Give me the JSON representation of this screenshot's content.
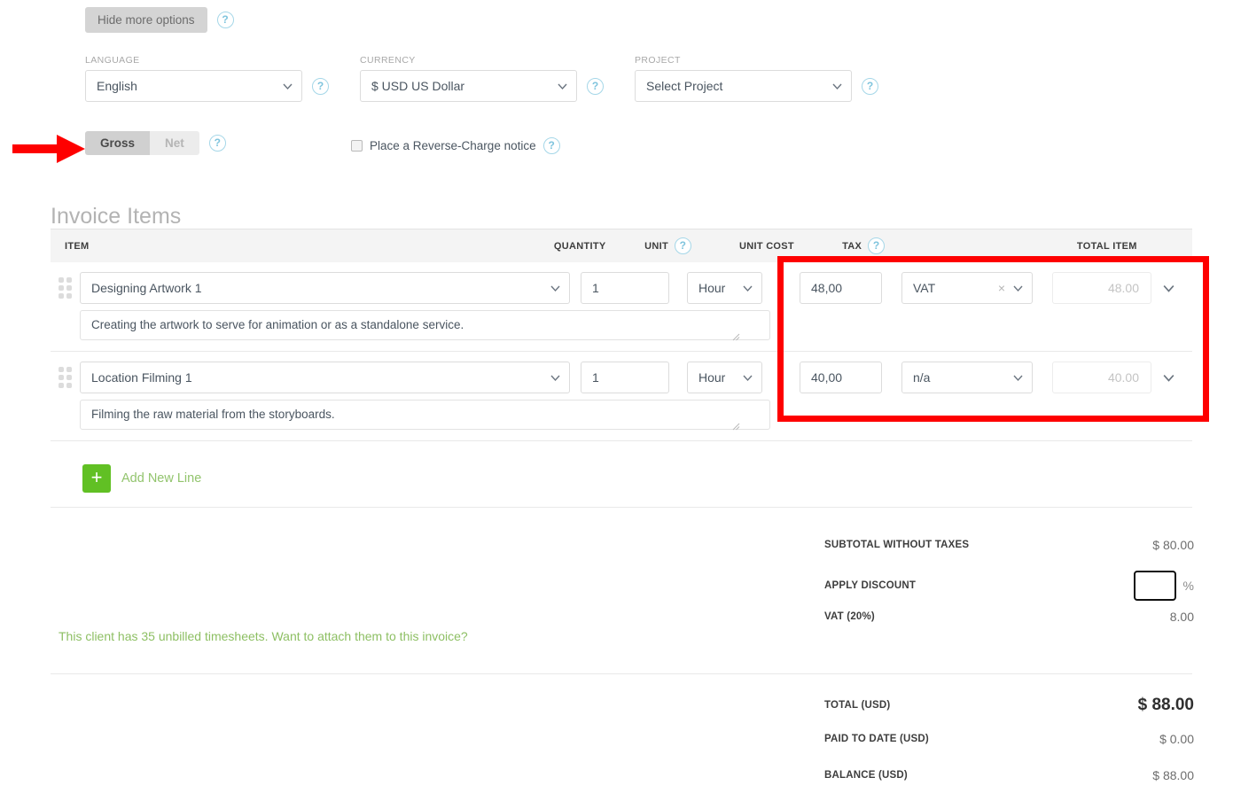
{
  "options": {
    "hide_more_label": "Hide more options",
    "help_icon": "help-icon"
  },
  "fields": {
    "language": {
      "label": "LANGUAGE",
      "value": "English"
    },
    "currency": {
      "label": "CURRENCY",
      "value": "$ USD US Dollar"
    },
    "project": {
      "label": "PROJECT",
      "value": "Select Project"
    }
  },
  "tax_mode": {
    "gross_label": "Gross",
    "net_label": "Net",
    "selected": "Gross"
  },
  "reverse_charge": {
    "label": "Place a Reverse-Charge notice",
    "checked": false
  },
  "items_section": {
    "title": "Invoice Items",
    "headers": {
      "item": "ITEM",
      "quantity": "QUANTITY",
      "unit": "UNIT",
      "unit_cost": "UNIT COST",
      "tax": "TAX",
      "total_item": "TOTAL ITEM"
    },
    "rows": [
      {
        "name": "Designing Artwork 1",
        "description": "Creating the artwork to serve for animation or as a standalone service.",
        "quantity": "1",
        "unit": "Hour",
        "unit_cost": "48,00",
        "tax": "VAT",
        "tax_clear": "×",
        "total": "48.00"
      },
      {
        "name": "Location Filming 1",
        "description": "Filming the raw material from the storyboards.",
        "quantity": "1",
        "unit": "Hour",
        "unit_cost": "40,00",
        "tax": "n/a",
        "tax_clear": "",
        "total": "40.00"
      }
    ],
    "add_new_line": "Add New Line",
    "add_plus": "+"
  },
  "timesheet_note": "This client has 35 unbilled timesheets. Want to attach them to this invoice?",
  "totals": {
    "subtotal_label": "SUBTOTAL WITHOUT TAXES",
    "subtotal_value": "$ 80.00",
    "discount_label": "APPLY DISCOUNT",
    "discount_value": "",
    "discount_suffix": "%",
    "vat_label": "VAT (20%)",
    "vat_value": "8.00",
    "total_label": "TOTAL (USD)",
    "total_value": "$ 88.00",
    "paid_label": "PAID TO DATE (USD)",
    "paid_value": "$ 0.00",
    "balance_label": "BALANCE (USD)",
    "balance_value": "$ 88.00"
  },
  "annotations": {
    "box_color": "#fe0000",
    "arrow_color": "#fe0000",
    "box_target": "tax-and-cost-columns",
    "arrow_target": "gross-net-toggle"
  }
}
